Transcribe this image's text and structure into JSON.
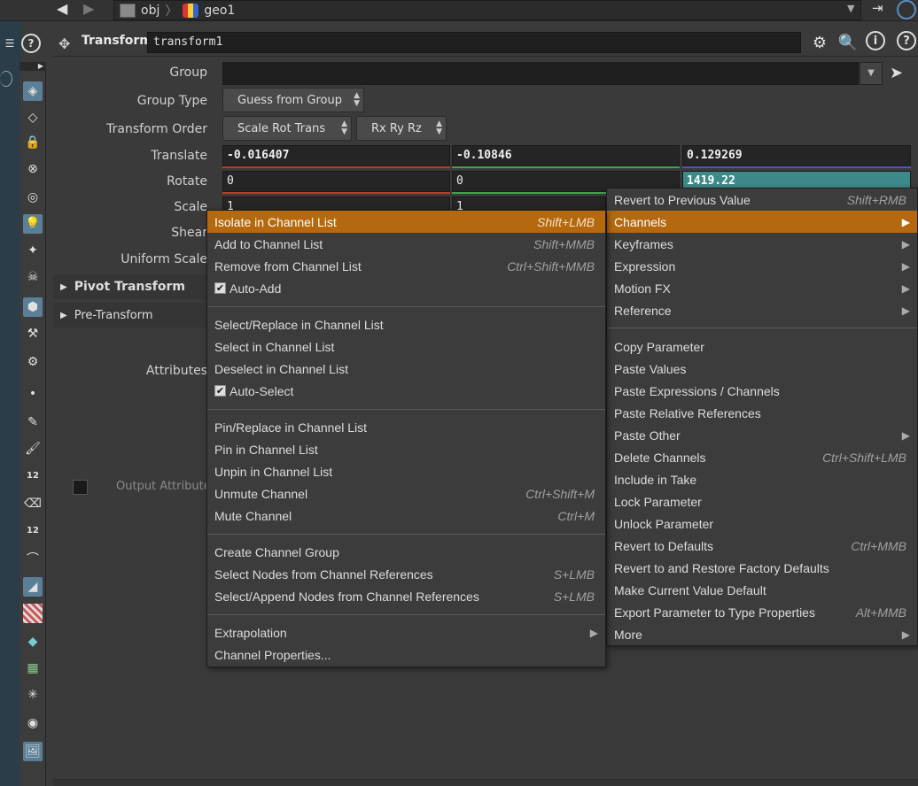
{
  "path": {
    "segments": [
      "obj",
      "geo1"
    ]
  },
  "node": {
    "type_label": "Transform",
    "name": "transform1"
  },
  "params": {
    "group_label": "Group",
    "group_value": "",
    "group_type_label": "Group Type",
    "group_type_value": "Guess from Group",
    "transform_order_label": "Transform Order",
    "transform_order_value": "Scale Rot Trans",
    "rotate_order_value": "Rx Ry Rz",
    "translate_label": "Translate",
    "translate": [
      "-0.016407",
      "-0.10846",
      "0.129269"
    ],
    "rotate_label": "Rotate",
    "rotate": [
      "0",
      "0",
      "1419.22"
    ],
    "scale_label": "Scale",
    "scale": [
      "1",
      "1"
    ],
    "shear_label": "Shear",
    "uniform_scale_label": "Uniform Scale",
    "pivot_transform_label": "Pivot Transform",
    "pre_transform_label": "Pre-Transform",
    "attributes_label": "Attributes",
    "output_attribute_label": "Output Attribute"
  },
  "main_menu": {
    "items": [
      {
        "label": "Revert to Previous Value",
        "shortcut": "Shift+RMB"
      },
      {
        "label": "Channels",
        "submenu": "▶"
      },
      {
        "label": "Keyframes",
        "submenu": "▶"
      },
      {
        "label": "Expression",
        "submenu": "▶"
      },
      {
        "label": "Motion FX",
        "submenu": "▶"
      },
      {
        "label": "Reference",
        "submenu": "▶"
      },
      {
        "label": "Copy Parameter"
      },
      {
        "label": "Paste Values"
      },
      {
        "label": "Paste Expressions / Channels"
      },
      {
        "label": "Paste Relative References"
      },
      {
        "label": "Paste Other",
        "submenu": "▶"
      },
      {
        "label": "Delete Channels",
        "shortcut": "Ctrl+Shift+LMB"
      },
      {
        "label": "Include in Take"
      },
      {
        "label": "Lock Parameter"
      },
      {
        "label": "Unlock Parameter"
      },
      {
        "label": "Revert to Defaults",
        "shortcut": "Ctrl+MMB"
      },
      {
        "label": "Revert to and Restore Factory Defaults"
      },
      {
        "label": "Make Current Value Default"
      },
      {
        "label": "Export Parameter to Type Properties",
        "shortcut": "Alt+MMB"
      },
      {
        "label": "More",
        "submenu": "▶"
      }
    ]
  },
  "channels_menu": {
    "items": [
      {
        "label": "Isolate in Channel List",
        "shortcut": "Shift+LMB"
      },
      {
        "label": "Add to Channel List",
        "shortcut": "Shift+MMB"
      },
      {
        "label": "Remove from Channel List",
        "shortcut": "Ctrl+Shift+MMB"
      },
      {
        "label": "Auto-Add",
        "checked": true
      },
      {
        "label": "Select/Replace in Channel List"
      },
      {
        "label": "Select in Channel List"
      },
      {
        "label": "Deselect in Channel List"
      },
      {
        "label": "Auto-Select",
        "checked": true
      },
      {
        "label": "Pin/Replace in Channel List"
      },
      {
        "label": "Pin in Channel List"
      },
      {
        "label": "Unpin in Channel List"
      },
      {
        "label": "Unmute Channel",
        "shortcut": "Ctrl+Shift+M"
      },
      {
        "label": "Mute Channel",
        "shortcut": "Ctrl+M"
      },
      {
        "label": "Create Channel Group"
      },
      {
        "label": "Select Nodes from Channel References",
        "shortcut": "S+LMB"
      },
      {
        "label": "Select/Append Nodes from Channel References",
        "shortcut": "S+LMB"
      },
      {
        "label": "Extrapolation",
        "submenu": "▶"
      },
      {
        "label": "Channel Properties..."
      }
    ]
  },
  "colors": {
    "highlight": "#b5690f",
    "x_axis": "#c0392b",
    "y_axis": "#3fa34d",
    "z_axis": "#5b4fc7",
    "selected_field": "#3e8a8a"
  }
}
